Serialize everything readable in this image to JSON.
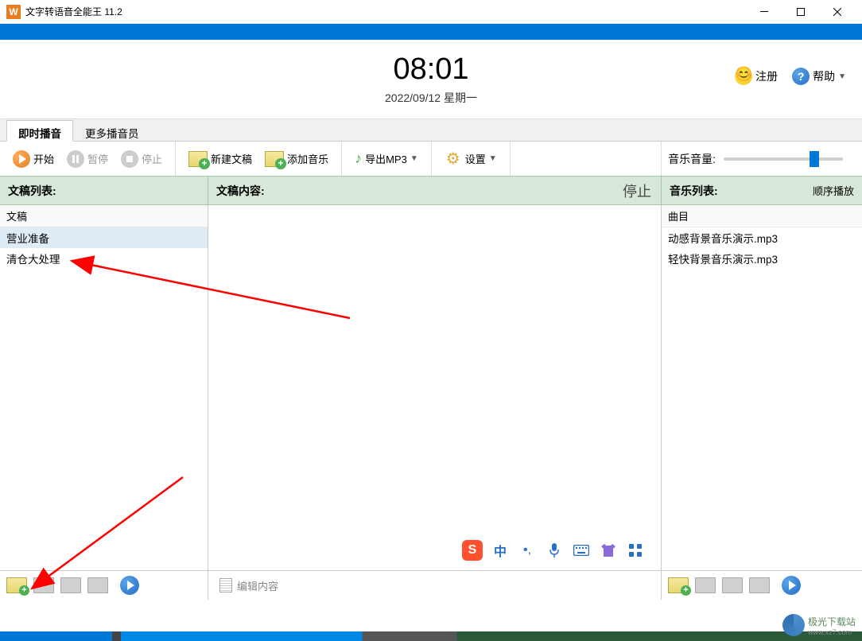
{
  "window": {
    "title": "文字转语音全能王 11.2"
  },
  "header": {
    "time": "08:01",
    "date": "2022/09/12 星期一",
    "register": "注册",
    "help": "帮助"
  },
  "tabs": {
    "instant": "即时播音",
    "more": "更多播音员"
  },
  "toolbar": {
    "start": "开始",
    "pause": "暂停",
    "stop": "停止",
    "new_doc": "新建文稿",
    "add_music": "添加音乐",
    "export_mp3": "导出MP3",
    "settings": "设置",
    "volume_label": "音乐音量:"
  },
  "columns": {
    "doc_list": "文稿列表:",
    "doc_content": "文稿内容:",
    "stop_status": "停止",
    "music_list": "音乐列表:",
    "play_mode": "顺序播放"
  },
  "doc_list": {
    "header": "文稿",
    "items": [
      "营业准备",
      "清仓大处理"
    ]
  },
  "music_list": {
    "header": "曲目",
    "items": [
      "动感背景音乐演示.mp3",
      "轻快背景音乐演示.mp3"
    ]
  },
  "ime": {
    "chinese": "中",
    "punct": "，",
    "mic": "🎤",
    "keyboard": "⌨",
    "theme": "👕",
    "grid": "⠿"
  },
  "bottom": {
    "edit_content": "编辑内容"
  },
  "watermark": {
    "text": "极光下载站",
    "sub": "www.xz7.com"
  }
}
